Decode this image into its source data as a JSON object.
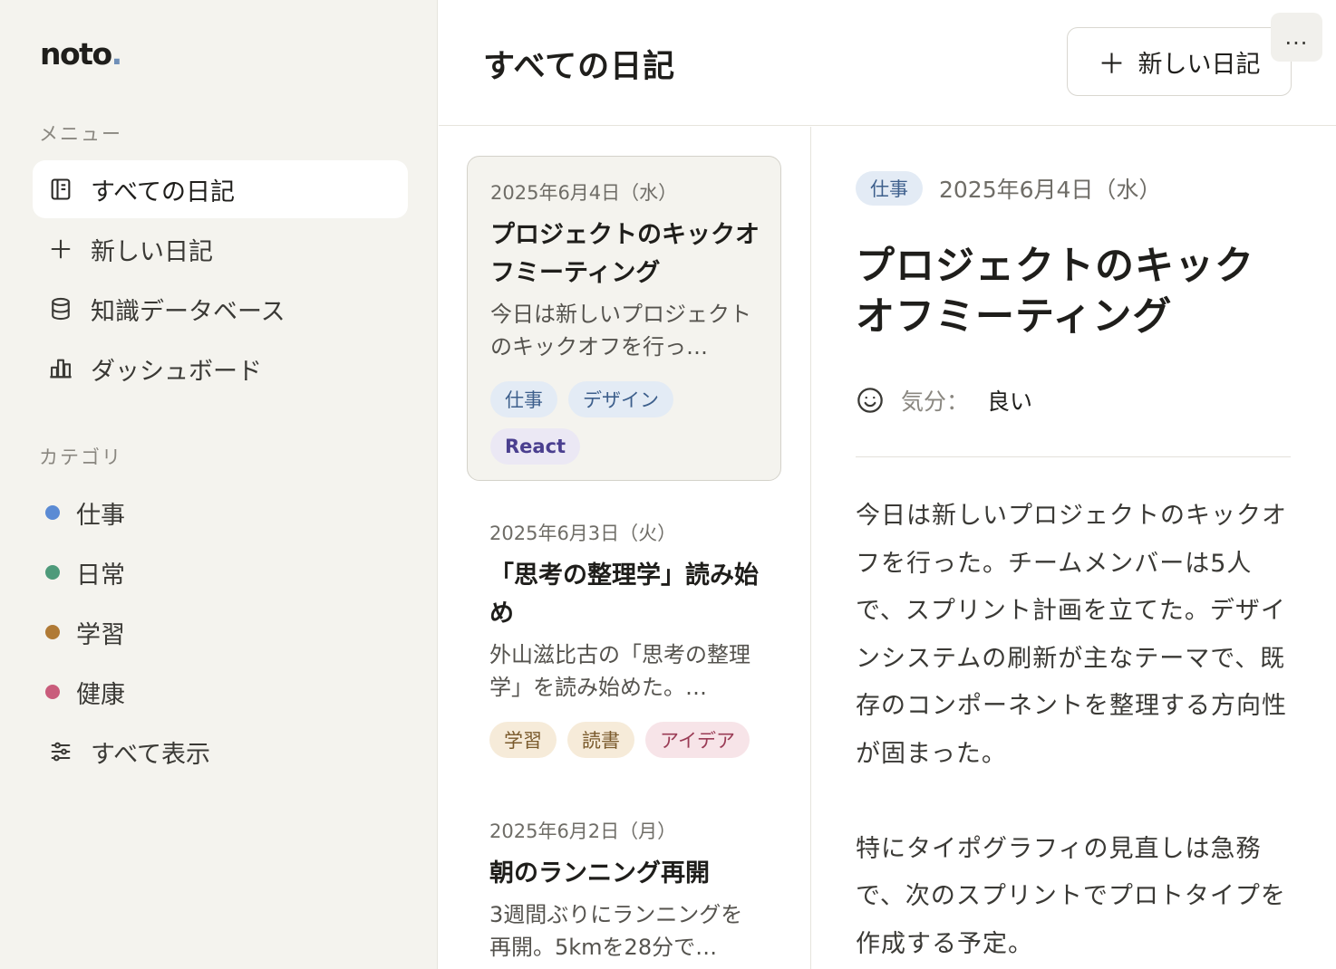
{
  "app": {
    "logo": "noto",
    "logo_dot": "."
  },
  "sidebar": {
    "menu_label": "メニュー",
    "menu": [
      {
        "label": "すべての日記",
        "icon": "notebook-icon",
        "active": true
      },
      {
        "label": "新しい日記",
        "icon": "plus-icon"
      },
      {
        "label": "知識データベース",
        "icon": "database-icon"
      },
      {
        "label": "ダッシュボード",
        "icon": "bar-chart-icon"
      }
    ],
    "categories_label": "カテゴリ",
    "categories": [
      {
        "label": "仕事",
        "color": "#5b8bd4"
      },
      {
        "label": "日常",
        "color": "#4e9a7a"
      },
      {
        "label": "学習",
        "color": "#b07a35"
      },
      {
        "label": "健康",
        "color": "#c95c7b"
      }
    ],
    "show_all": "すべて表示"
  },
  "header": {
    "title": "すべての日記",
    "new_button": "新しい日記",
    "more": "..."
  },
  "entries": [
    {
      "date": "2025年6月4日（水）",
      "title": "プロジェクトのキックオフミーティング",
      "excerpt": "今日は新しいプロジェクトのキックオフを行っ…",
      "tags": [
        {
          "label": "仕事"
        },
        {
          "label": "デザイン"
        },
        {
          "label": "React"
        }
      ]
    },
    {
      "date": "2025年6月3日（火）",
      "title": "「思考の整理学」読み始め",
      "excerpt": "外山滋比古の「思考の整理学」を読み始めた。…",
      "tags": [
        {
          "label": "学習"
        },
        {
          "label": "読書"
        },
        {
          "label": "アイデア"
        }
      ]
    },
    {
      "date": "2025年6月2日（月）",
      "title": "朝のランニング再開",
      "excerpt": "3週間ぶりにランニングを再開。5kmを28分で…",
      "tags": []
    }
  ],
  "detail": {
    "category": "仕事",
    "date": "2025年6月4日（水）",
    "title": "プロジェクトのキックオフミーティング",
    "mood_label": "気分：",
    "mood_value": "良い",
    "mood_icon": "smile-icon",
    "body": "今日は新しいプロジェクトのキックオフを行った。チームメンバーは5人で、スプリント計画を立てた。デザインシステムの刷新が主なテーマで、既存のコンポーネントを整理する方向性が固まった。\n\n特にタイポグラフィの見直しは急務で、次のスプリントでプロトタイプを作成する予定。"
  }
}
